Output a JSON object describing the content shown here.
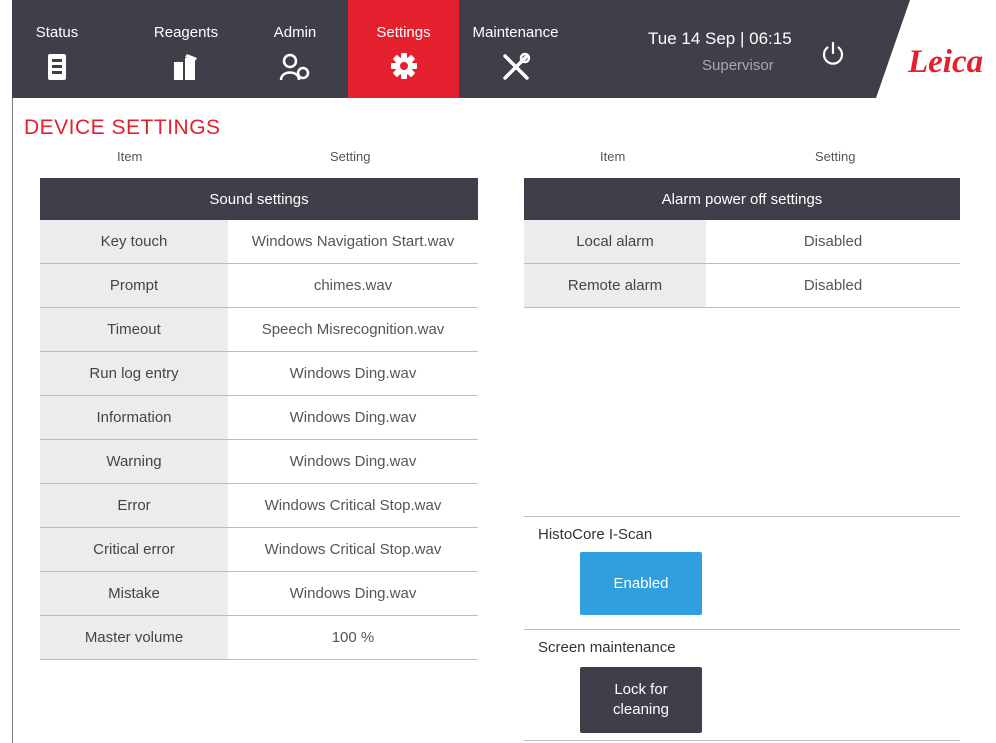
{
  "nav": {
    "tabs": [
      {
        "label": "Status",
        "icon": "status-icon"
      },
      {
        "label": "Reagents",
        "icon": "reagents-icon"
      },
      {
        "label": "Admin",
        "icon": "admin-icon"
      },
      {
        "label": "Settings",
        "icon": "gear-icon",
        "active": true
      },
      {
        "label": "Maintenance",
        "icon": "tools-icon"
      }
    ],
    "datetime": "Tue 14 Sep | 06:15",
    "role": "Supervisor",
    "logo": "Leica"
  },
  "page": {
    "title": "DEVICE SETTINGS"
  },
  "columns": {
    "item": "Item",
    "setting": "Setting"
  },
  "sound": {
    "header": "Sound settings",
    "rows": [
      {
        "item": "Key touch",
        "value": "Windows Navigation Start.wav"
      },
      {
        "item": "Prompt",
        "value": "chimes.wav"
      },
      {
        "item": "Timeout",
        "value": "Speech Misrecognition.wav"
      },
      {
        "item": "Run log entry",
        "value": "Windows Ding.wav"
      },
      {
        "item": "Information",
        "value": "Windows Ding.wav"
      },
      {
        "item": "Warning",
        "value": "Windows Ding.wav"
      },
      {
        "item": "Error",
        "value": "Windows Critical Stop.wav"
      },
      {
        "item": "Critical error",
        "value": "Windows Critical Stop.wav"
      },
      {
        "item": "Mistake",
        "value": "Windows Ding.wav"
      },
      {
        "item": "Master volume",
        "value": "100 %"
      }
    ]
  },
  "alarm": {
    "header": "Alarm power off settings",
    "rows": [
      {
        "item": "Local alarm",
        "value": "Disabled"
      },
      {
        "item": "Remote alarm",
        "value": "Disabled"
      }
    ]
  },
  "iscan": {
    "label": "HistoCore I-Scan",
    "button": "Enabled"
  },
  "screen": {
    "label": "Screen maintenance",
    "button_line1": "Lock for",
    "button_line2": "cleaning"
  },
  "colors": {
    "accent": "#e5202e",
    "dark": "#3e3f48",
    "blue": "#2f9fe0"
  }
}
